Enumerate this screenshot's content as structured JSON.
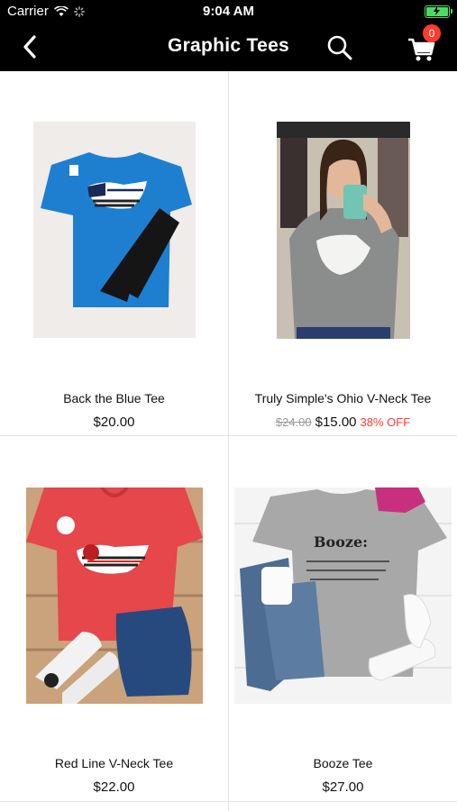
{
  "status": {
    "carrier": "Carrier",
    "time": "9:04 AM"
  },
  "nav": {
    "title": "Graphic Tees",
    "cart_count": "0"
  },
  "products": [
    {
      "name": "Back the Blue Tee",
      "price": "$20.00",
      "old_price": "",
      "discount": ""
    },
    {
      "name": "Truly Simple's Ohio V-Neck Tee",
      "price": "$15.00",
      "old_price": "$24.00",
      "discount": "38% OFF"
    },
    {
      "name": "Red Line V-Neck Tee",
      "price": "$22.00",
      "old_price": "",
      "discount": ""
    },
    {
      "name": "Booze Tee",
      "price": "$27.00",
      "old_price": "",
      "discount": ""
    }
  ],
  "colors": {
    "bar": "#000000",
    "badge": "#ff3b30",
    "discount": "#ff3b30",
    "battery": "#4cd964"
  }
}
